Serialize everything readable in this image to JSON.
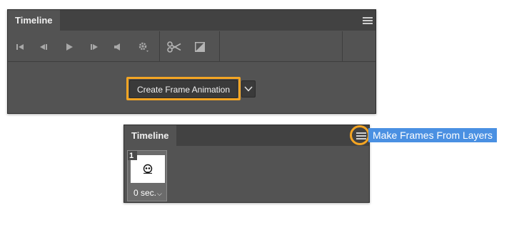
{
  "top_panel": {
    "tab_title": "Timeline",
    "toolbar": {
      "icons": [
        "go-to-first-frame-icon",
        "previous-frame-icon",
        "play-icon",
        "next-frame-icon",
        "audio-icon",
        "settings-icon",
        "split-scissors-icon",
        "transition-icon"
      ]
    },
    "create_button_label": "Create Frame Animation"
  },
  "bottom_panel": {
    "tab_title": "Timeline",
    "frames": [
      {
        "number": "1",
        "delay": "0 sec."
      }
    ]
  },
  "panel_menu_item": "Make Frames From Layers",
  "colors": {
    "highlight": "#f4a523",
    "menu_selection": "#4a90e2",
    "panel_bg": "#535353",
    "tab_bar_bg": "#424242"
  }
}
